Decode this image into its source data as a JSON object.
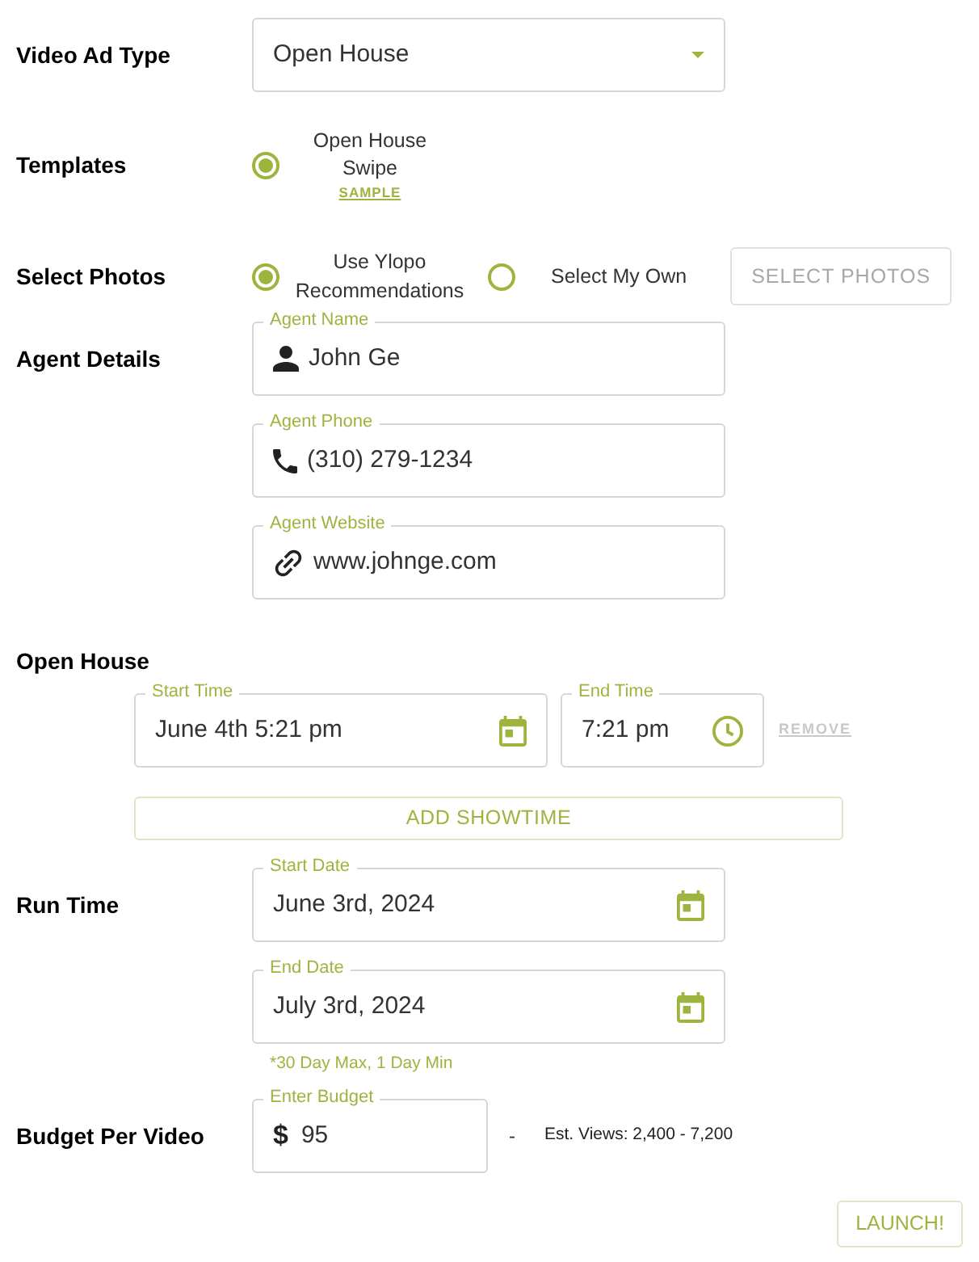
{
  "video_ad_type": {
    "label": "Video Ad Type",
    "value": "Open House"
  },
  "templates": {
    "label": "Templates",
    "options": [
      {
        "label": "Open House Swipe",
        "link": "SAMPLE",
        "selected": true
      }
    ]
  },
  "select_photos": {
    "label": "Select Photos",
    "options": [
      {
        "label": "Use Ylopo Recommendations",
        "selected": true
      },
      {
        "label": "Select My Own",
        "selected": false
      }
    ],
    "button": {
      "label": "SELECT PHOTOS",
      "disabled": true
    }
  },
  "agent_details": {
    "label": "Agent Details",
    "fields": [
      {
        "kind": "person",
        "label": "Agent Name",
        "value": "John Ge"
      },
      {
        "kind": "phone",
        "label": "Agent Phone",
        "value": "(310) 279-1234"
      },
      {
        "kind": "link",
        "label": "Agent Website",
        "value": "www.johnge.com"
      }
    ]
  },
  "open_house": {
    "label": "Open House",
    "showtimes": [
      {
        "start": {
          "label": "Start Time",
          "value": "June 4th 5:21 pm"
        },
        "end": {
          "label": "End Time",
          "value": "7:21 pm"
        },
        "remove": "REMOVE"
      }
    ],
    "add_button": "ADD SHOWTIME"
  },
  "run_time": {
    "label": "Run Time",
    "fields": [
      {
        "label": "Start Date",
        "value": "June 3rd, 2024"
      },
      {
        "label": "End Date",
        "value": "July 3rd, 2024"
      }
    ],
    "hint": "*30 Day Max, 1 Day Min"
  },
  "budget": {
    "label": "Budget Per Video",
    "field": {
      "label": "Enter Budget",
      "prefix": "$",
      "value": "95"
    },
    "separator": "-",
    "estimate": "Est. Views: 2,400 - 7,200"
  },
  "launch_button": "LAUNCH!"
}
